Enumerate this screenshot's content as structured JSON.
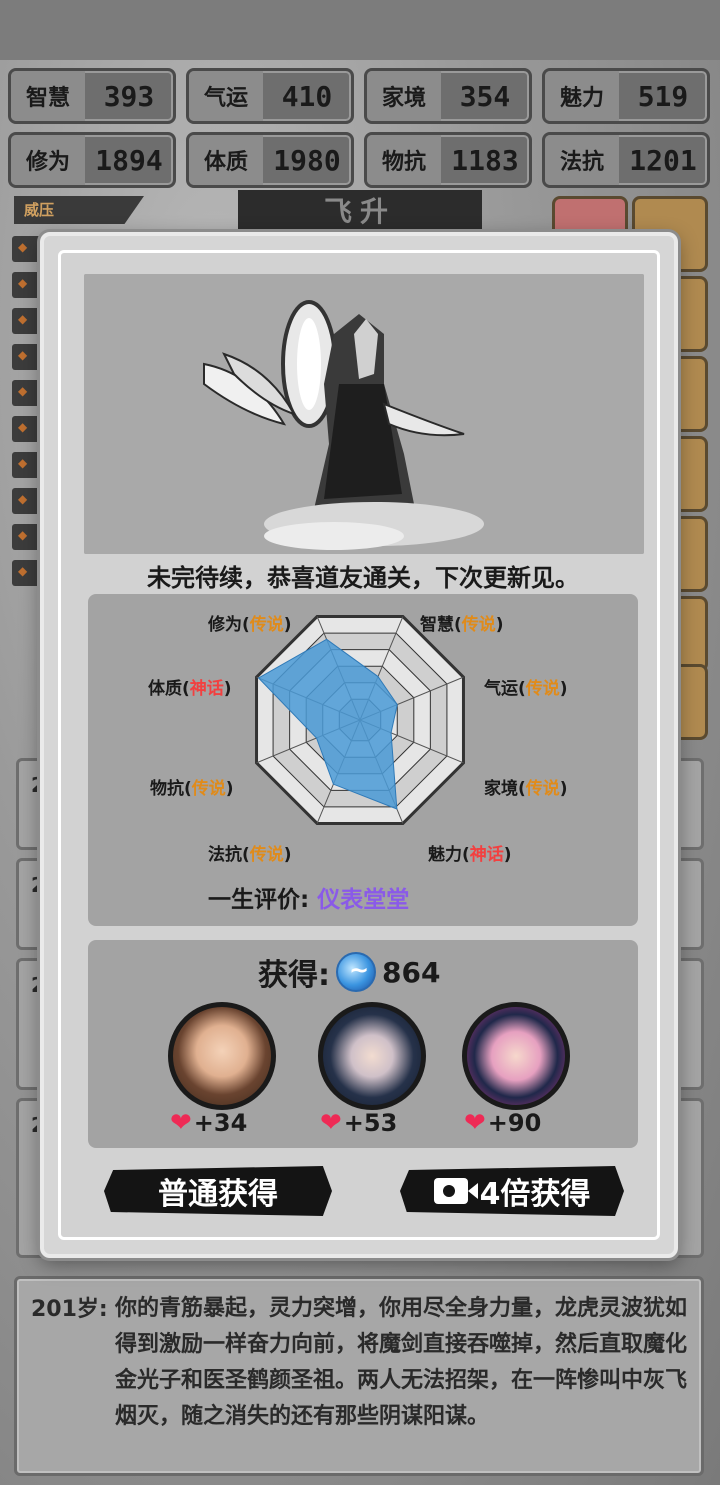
{
  "stats": [
    {
      "name": "智慧",
      "value": "393"
    },
    {
      "name": "气运",
      "value": "410"
    },
    {
      "name": "家境",
      "value": "354"
    },
    {
      "name": "魅力",
      "value": "519"
    },
    {
      "name": "修为",
      "value": "1894"
    },
    {
      "name": "体质",
      "value": "1980"
    },
    {
      "name": "物抗",
      "value": "1183"
    },
    {
      "name": "法抗",
      "value": "1201"
    }
  ],
  "background": {
    "weiya_tag": "威压",
    "banner": "飞升",
    "log_ages": [
      "2",
      "2",
      "2",
      "2"
    ],
    "bottom_log": {
      "age": "201岁:",
      "text": "你的青筋暴起，灵力突增，你用尽全身力量，龙虎灵波犹如得到激励一样奋力向前，将魔剑直接吞噬掉，然后直取魔化金光子和医圣鹤颜圣祖。两人无法招架，在一阵惨叫中灰飞烟灭，随之消失的还有那些阴谋阳谋。"
    }
  },
  "modal": {
    "message": "未完待续，恭喜道友通关，下次更新见。",
    "radar": {
      "labels": [
        {
          "stat": "修为",
          "open": "(",
          "rank": "传说",
          "close": ")",
          "rank_type": "legend"
        },
        {
          "stat": "智慧",
          "open": "(",
          "rank": "传说",
          "close": ")",
          "rank_type": "legend"
        },
        {
          "stat": "气运",
          "open": "(",
          "rank": "传说",
          "close": ")",
          "rank_type": "legend"
        },
        {
          "stat": "家境",
          "open": "(",
          "rank": "传说",
          "close": ")",
          "rank_type": "legend"
        },
        {
          "stat": "魅力",
          "open": "(",
          "rank": "神话",
          "close": ")",
          "rank_type": "myth"
        },
        {
          "stat": "法抗",
          "open": "(",
          "rank": "传说",
          "close": ")",
          "rank_type": "legend"
        },
        {
          "stat": "物抗",
          "open": "(",
          "rank": "传说",
          "close": ")",
          "rank_type": "legend"
        },
        {
          "stat": "体质",
          "open": "(",
          "rank": "神话",
          "close": ")",
          "rank_type": "myth"
        }
      ],
      "levels": [
        0.78,
        0.42,
        0.36,
        0.3,
        0.86,
        0.62,
        0.42,
        0.98
      ],
      "fill_color": "#4a9ad6",
      "legend_color": "#e08b1a",
      "myth_color": "#f24040"
    },
    "evaluation_label": "一生评价:",
    "evaluation_value": "仪表堂堂",
    "gain_label": "获得:",
    "gain_value": "864",
    "companions": [
      {
        "hearts": "+34"
      },
      {
        "hearts": "+53"
      },
      {
        "hearts": "+90"
      }
    ],
    "btn_normal": "普通获得",
    "btn_4x": "4倍获得"
  }
}
